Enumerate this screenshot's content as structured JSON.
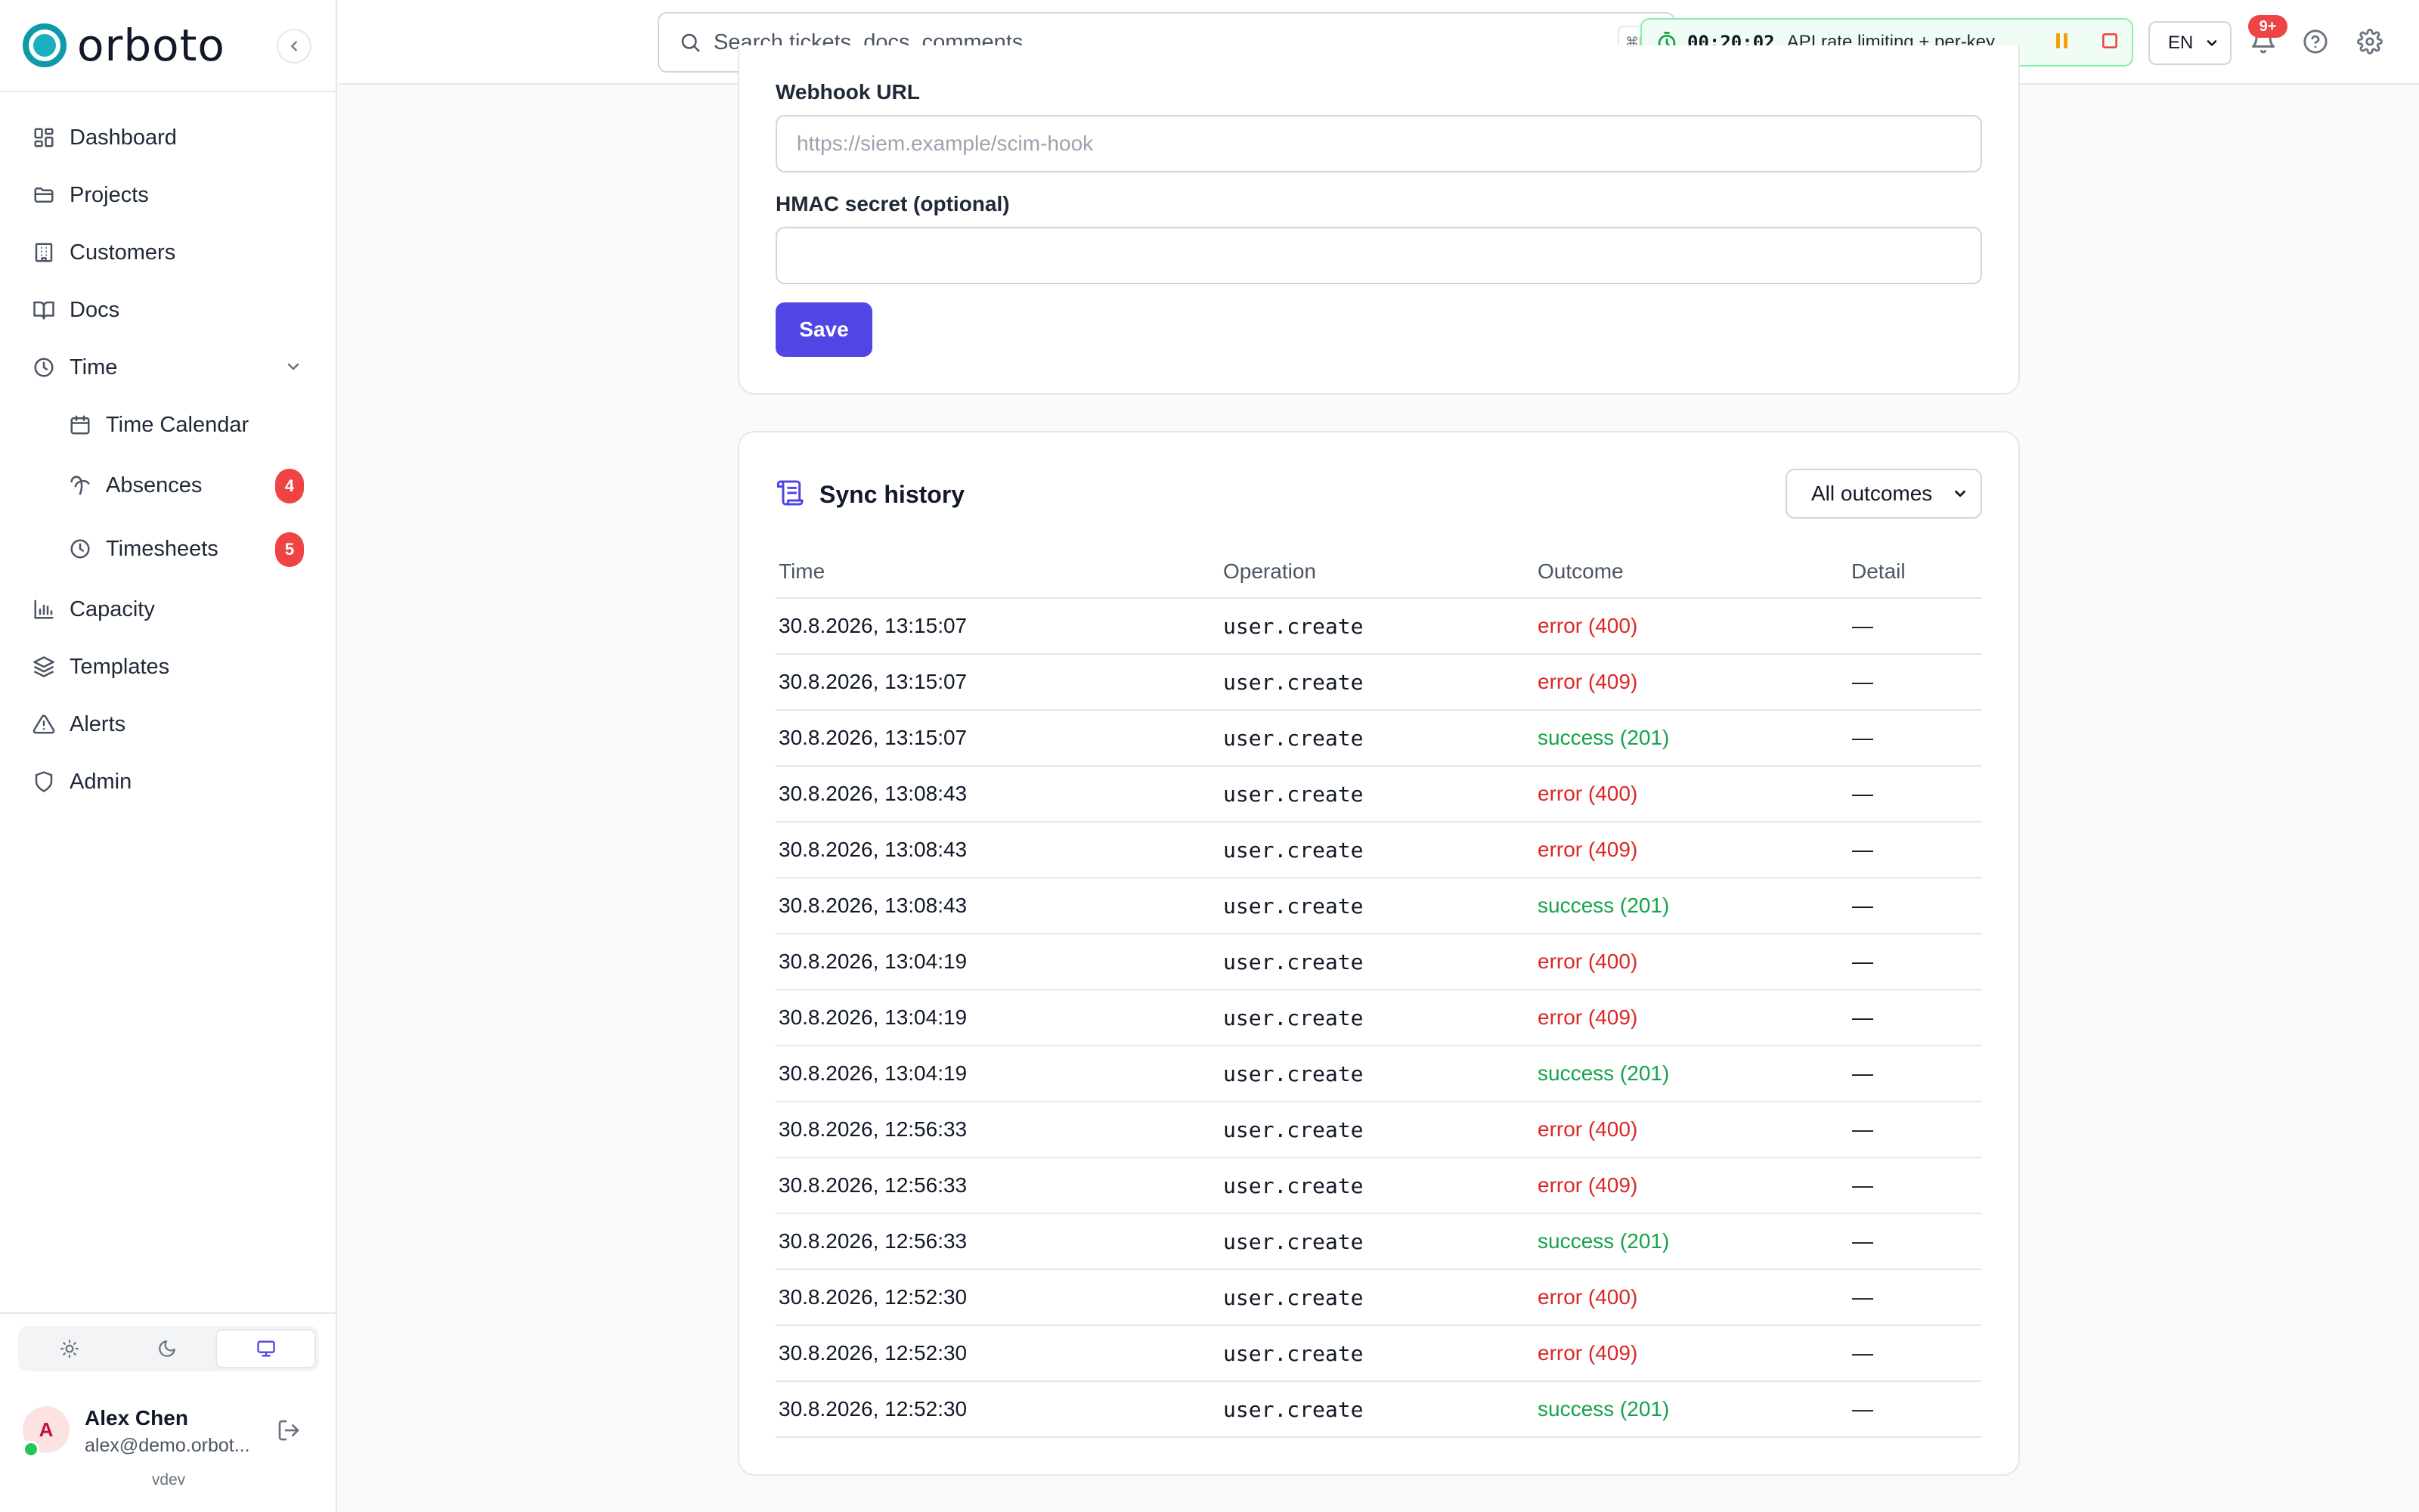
{
  "brand": {
    "name": "orboto"
  },
  "sidebar": {
    "items": [
      {
        "key": "dashboard",
        "label": "Dashboard",
        "icon": "dashboard-icon"
      },
      {
        "key": "projects",
        "label": "Projects",
        "icon": "folder-icon"
      },
      {
        "key": "customers",
        "label": "Customers",
        "icon": "building-icon"
      },
      {
        "key": "docs",
        "label": "Docs",
        "icon": "book-icon"
      },
      {
        "key": "time",
        "label": "Time",
        "icon": "clock-icon",
        "expanded": true
      },
      {
        "key": "time-calendar",
        "label": "Time Calendar",
        "icon": "calendar-icon",
        "sub": true
      },
      {
        "key": "absences",
        "label": "Absences",
        "icon": "palm-tree-icon",
        "sub": true,
        "badge": "4"
      },
      {
        "key": "timesheets",
        "label": "Timesheets",
        "icon": "clock-icon",
        "sub": true,
        "badge": "5"
      },
      {
        "key": "capacity",
        "label": "Capacity",
        "icon": "bar-chart-icon"
      },
      {
        "key": "templates",
        "label": "Templates",
        "icon": "layers-icon"
      },
      {
        "key": "alerts",
        "label": "Alerts",
        "icon": "warning-icon"
      },
      {
        "key": "admin",
        "label": "Admin",
        "icon": "shield-icon"
      }
    ],
    "theme_options": [
      "light",
      "dark",
      "system"
    ],
    "theme_active": "system",
    "user": {
      "initial": "A",
      "name": "Alex Chen",
      "email": "alex@demo.orbot..."
    },
    "version": "vdev"
  },
  "topbar": {
    "search_placeholder": "Search tickets, docs, comments...",
    "search_shortcut": "⌘K",
    "timer": {
      "time": "00:20:02",
      "task": "API rate limiting + per-key ..."
    },
    "language": "EN",
    "notifications_badge": "9+"
  },
  "webhook": {
    "url_label": "Webhook URL",
    "url_placeholder": "https://siem.example/scim-hook",
    "secret_label": "HMAC secret (optional)",
    "secret_value": "",
    "save_label": "Save"
  },
  "sync_history": {
    "title": "Sync history",
    "filter_value": "All outcomes",
    "columns": {
      "time": "Time",
      "operation": "Operation",
      "outcome": "Outcome",
      "detail": "Detail"
    },
    "rows": [
      {
        "time": "30.8.2026, 13:15:07",
        "operation": "user.create",
        "outcome": "error (400)",
        "status": "error",
        "detail": "—"
      },
      {
        "time": "30.8.2026, 13:15:07",
        "operation": "user.create",
        "outcome": "error (409)",
        "status": "error",
        "detail": "—"
      },
      {
        "time": "30.8.2026, 13:15:07",
        "operation": "user.create",
        "outcome": "success (201)",
        "status": "success",
        "detail": "—"
      },
      {
        "time": "30.8.2026, 13:08:43",
        "operation": "user.create",
        "outcome": "error (400)",
        "status": "error",
        "detail": "—"
      },
      {
        "time": "30.8.2026, 13:08:43",
        "operation": "user.create",
        "outcome": "error (409)",
        "status": "error",
        "detail": "—"
      },
      {
        "time": "30.8.2026, 13:08:43",
        "operation": "user.create",
        "outcome": "success (201)",
        "status": "success",
        "detail": "—"
      },
      {
        "time": "30.8.2026, 13:04:19",
        "operation": "user.create",
        "outcome": "error (400)",
        "status": "error",
        "detail": "—"
      },
      {
        "time": "30.8.2026, 13:04:19",
        "operation": "user.create",
        "outcome": "error (409)",
        "status": "error",
        "detail": "—"
      },
      {
        "time": "30.8.2026, 13:04:19",
        "operation": "user.create",
        "outcome": "success (201)",
        "status": "success",
        "detail": "—"
      },
      {
        "time": "30.8.2026, 12:56:33",
        "operation": "user.create",
        "outcome": "error (400)",
        "status": "error",
        "detail": "—"
      },
      {
        "time": "30.8.2026, 12:56:33",
        "operation": "user.create",
        "outcome": "error (409)",
        "status": "error",
        "detail": "—"
      },
      {
        "time": "30.8.2026, 12:56:33",
        "operation": "user.create",
        "outcome": "success (201)",
        "status": "success",
        "detail": "—"
      },
      {
        "time": "30.8.2026, 12:52:30",
        "operation": "user.create",
        "outcome": "error (400)",
        "status": "error",
        "detail": "—"
      },
      {
        "time": "30.8.2026, 12:52:30",
        "operation": "user.create",
        "outcome": "error (409)",
        "status": "error",
        "detail": "—"
      },
      {
        "time": "30.8.2026, 12:52:30",
        "operation": "user.create",
        "outcome": "success (201)",
        "status": "success",
        "detail": "—"
      }
    ]
  },
  "colors": {
    "accent": "#4f46e5",
    "error": "#dc2626",
    "success": "#16a34a",
    "badge": "#ef4444",
    "brand": "#0e9aa8"
  }
}
